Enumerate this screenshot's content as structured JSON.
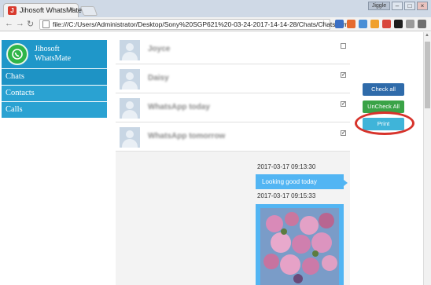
{
  "browser": {
    "tab_title": "Jihosoft WhatsMate",
    "tab_close": "×",
    "address": "file:///C:/Users/Administrator/Desktop/Sony%20SGP621%20-03-24-2017-14-14-28/Chats/Chats.html",
    "user_chip": "Jiggle",
    "win_minimize": "–",
    "win_maximize": "□",
    "win_close": "×",
    "back": "←",
    "forward": "→",
    "reload": "↻",
    "star": "☆"
  },
  "sidebar": {
    "brand": "Jihosoft WhatsMate",
    "items": [
      {
        "label": "Chats"
      },
      {
        "label": "Contacts"
      },
      {
        "label": "Calls"
      }
    ]
  },
  "chats": [
    {
      "name": "Joyce",
      "checked": false
    },
    {
      "name": "Daisy",
      "checked": true
    },
    {
      "name": "WhatsApp today",
      "checked": true
    },
    {
      "name": "WhatsApp tomorrow",
      "checked": true
    }
  ],
  "conversation": {
    "msg1_time": "2017-03-17 09:13:30",
    "msg1_text": "Looking good today",
    "msg2_time": "2017-03-17 09:15:33"
  },
  "actions": {
    "check_all": "Check all",
    "uncheck_all": "UnCheck All",
    "print": "Print"
  },
  "colors": {
    "accent": "#1f97c9",
    "bubble": "#52b5f3",
    "highlight": "#d7332b"
  }
}
